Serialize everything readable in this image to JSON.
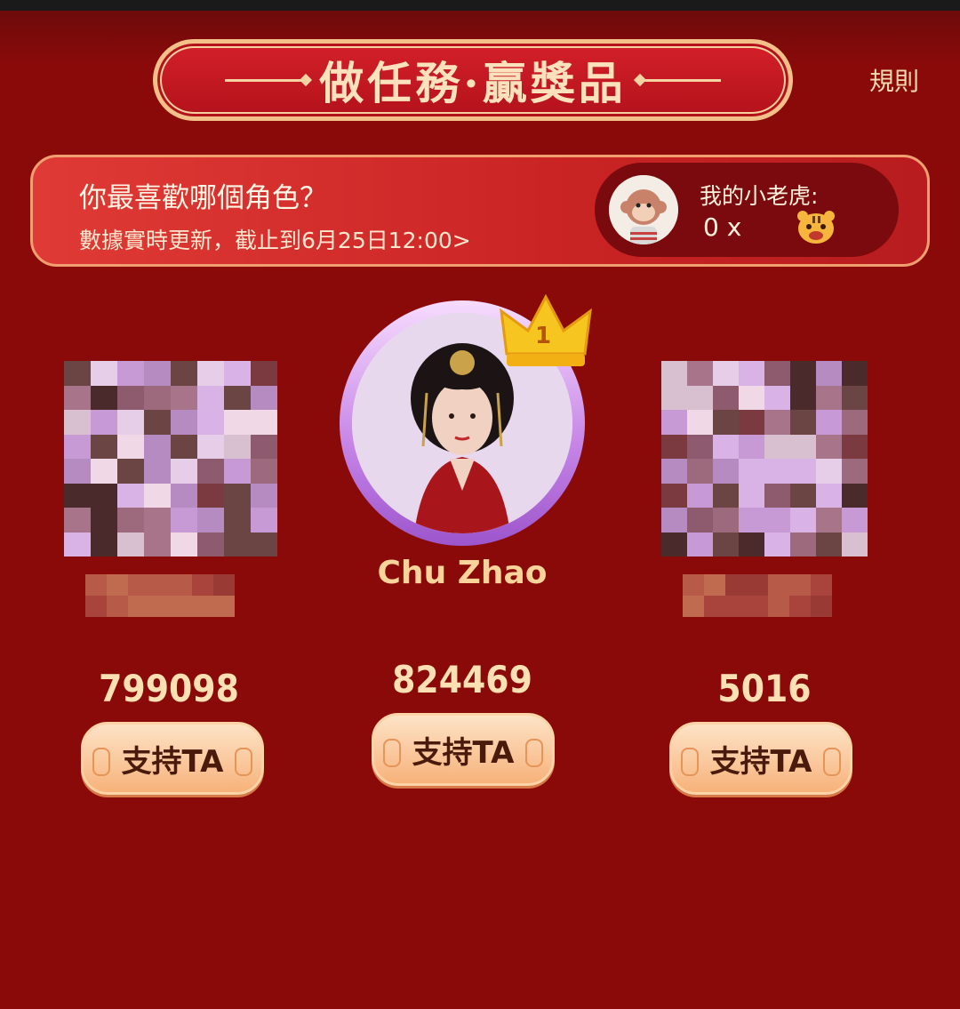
{
  "banner": {
    "title": "做任務·贏獎品"
  },
  "rules_label": "規則",
  "question": {
    "title": "你最喜歡哪個角色？",
    "subtitle": "數據實時更新，截止到6月25日12:00>"
  },
  "my_tiger": {
    "label": "我的小老虎:",
    "count": "0 x"
  },
  "candidates": [
    {
      "name": "",
      "votes": "799098",
      "button": "支持TA"
    },
    {
      "name": "Chu Zhao",
      "votes": "824469",
      "button": "支持TA",
      "rank": "1"
    },
    {
      "name": "",
      "votes": "5016",
      "button": "支持TA"
    }
  ],
  "colors": {
    "background": "#8a0a0a",
    "accent_gold": "#f8d49a",
    "button": "#f7b27a"
  }
}
